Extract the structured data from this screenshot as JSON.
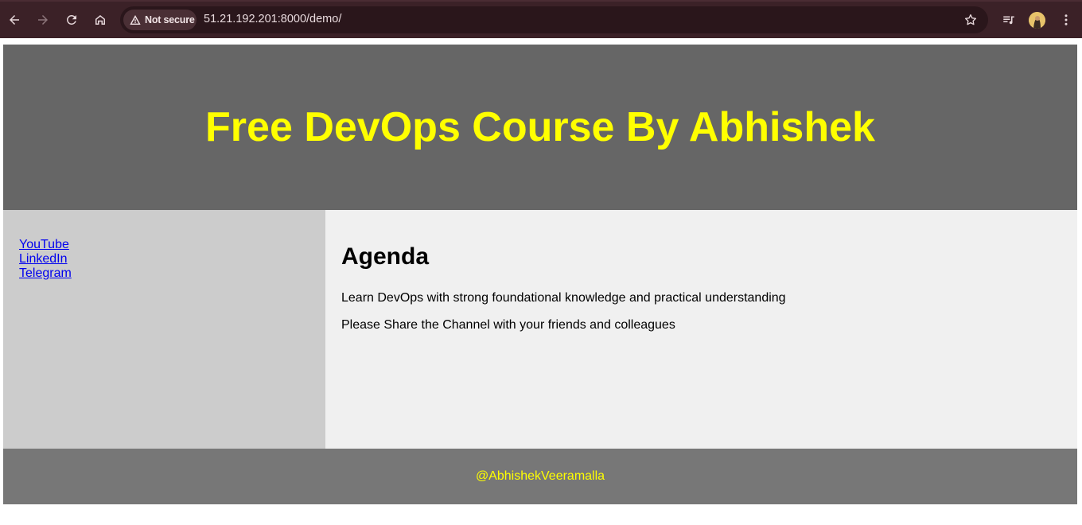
{
  "browser": {
    "security_label": "Not secure",
    "url": "51.21.192.201:8000/demo/",
    "icons": [
      "back-icon",
      "forward-icon",
      "reload-icon",
      "home-icon",
      "warning-icon",
      "star-icon",
      "reading-list-icon",
      "avatar",
      "menu-icon"
    ]
  },
  "header": {
    "title": "Free DevOps Course By Abhishek"
  },
  "sidebar": {
    "links": [
      {
        "label": "YouTube"
      },
      {
        "label": "LinkedIn"
      },
      {
        "label": "Telegram"
      }
    ]
  },
  "main": {
    "heading": "Agenda",
    "paragraphs": [
      "Learn DevOps with strong foundational knowledge and practical understanding",
      "Please Share the Channel with your friends and colleagues"
    ]
  },
  "footer": {
    "text": "@AbhishekVeeramalla"
  },
  "colors": {
    "header_bg": "#666666",
    "header_text": "#ffff00",
    "sidebar_bg": "#cccccc",
    "content_bg": "#f0f0f0",
    "footer_bg": "#777777",
    "footer_text": "#ffff00",
    "link": "#0000ee"
  }
}
